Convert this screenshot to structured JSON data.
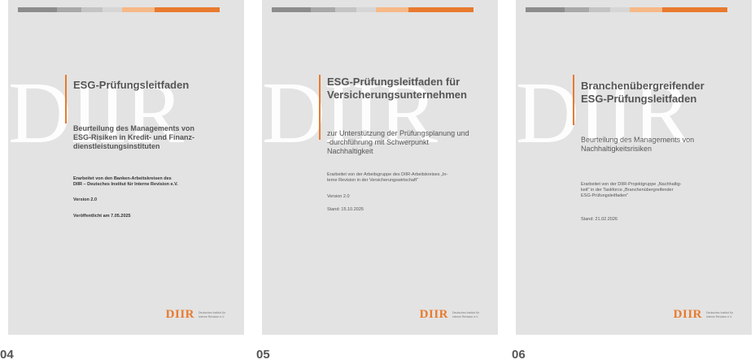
{
  "colors": {
    "strip": [
      "#8c8c8c",
      "#a3a3a3",
      "#bdbdbd",
      "#cfcfcf",
      "#f3a46c",
      "#e87a2e"
    ],
    "accent": "#e87a2e",
    "watermark": "#ffffff",
    "cover_bg": "#e3e3e3"
  },
  "cards": [
    {
      "number": "04",
      "watermark": "DIIR",
      "title_lines": [
        "ESG-Prüfungsleitfaden"
      ],
      "subtitle_lines": [
        "Beurteilung des Managements von",
        "ESG-Risiken in Kredit- und Finanz-",
        "dienstleistungsinstituten"
      ],
      "info_lines": [
        "Erarbeitet von den Banken-Arbeitskreisen des",
        "DIIR – Deutsches Institut für Interne Revision e.V."
      ],
      "version": "Version 2.0",
      "date": "Veröffentlicht am 7.05.2025",
      "logo": "DIIR",
      "logo_sub": "Deutsches Institut für Interne Revision e.V."
    },
    {
      "number": "05",
      "watermark": "DIIR",
      "title_lines": [
        "ESG-Prüfungsleitfaden für",
        "Versicherungsunternehmen"
      ],
      "subtitle_lines": [
        "zur Unterstützung der Prüfungsplanung und",
        "-durchführung mit Schwerpunkt",
        "Nachhaltigkeit"
      ],
      "info_lines": [
        "Erarbeitet von der Arbeitsgruppe des DIIR-Arbeitskreises „In-",
        "terne Revision in der Versicherungswirtschaft\""
      ],
      "version": "Version 2.0",
      "date": "Stand: 15.10.2025",
      "logo": "DIIR",
      "logo_sub": "Deutsches Institut für Interne Revision e.V."
    },
    {
      "number": "06",
      "watermark": "DIIR",
      "title_lines": [
        "Branchenübergreifender",
        "ESG-Prüfungsleitfaden"
      ],
      "subtitle_lines": [
        "Beurteilung des Managements von",
        "Nachhaltigkeitsrisiken"
      ],
      "info_lines": [
        "Erarbeitet von der DIIR-Projektgruppe „Nachhaltig-",
        "keit\" in der Taskforce „Branchenübergreifender",
        "ESG-Prüfungsleitfaden\""
      ],
      "version": "",
      "date": "Stand: 21.02.2026",
      "logo": "DIIR",
      "logo_sub": "Deutsches Institut für Interne Revision e.V."
    }
  ]
}
